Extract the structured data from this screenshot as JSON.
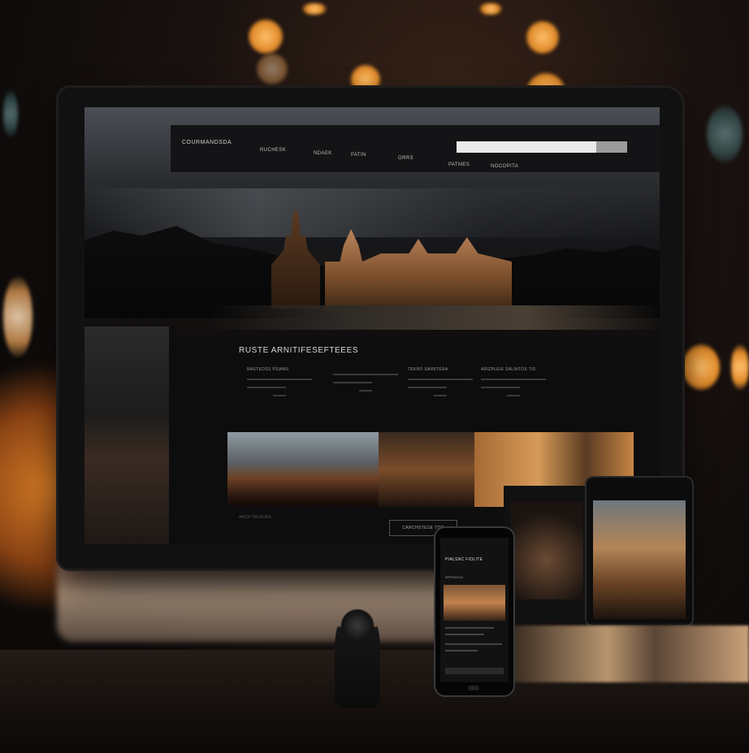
{
  "scene": {
    "description_colors": {
      "warm_bokeh": "#ffbf6a",
      "cool_bokeh": "#7fa8a8",
      "desk": "#231b16"
    }
  },
  "website": {
    "brand": "COURMANDSDA",
    "nav": [
      "RUCHESK",
      "NDAEK",
      "PATIN",
      "ORRS",
      "PATMES",
      "NOCOPITA"
    ],
    "section_title": "RUSTE ARNITIFESEFTEEES",
    "columns": [
      {
        "heading": "RASTEOSS PSIANS"
      },
      {
        "heading": ""
      },
      {
        "heading": "TEKRO SAINITERA"
      },
      {
        "heading": "ARIZPLEIE SALINTOS TIS"
      }
    ],
    "gallery_caption": "ANCH TRUSONS",
    "cta_label": "CARCHSTESE TOC"
  },
  "phone": {
    "title": "PIALSNC  FIOLITE",
    "subtitle": "RRTRATLIA"
  }
}
